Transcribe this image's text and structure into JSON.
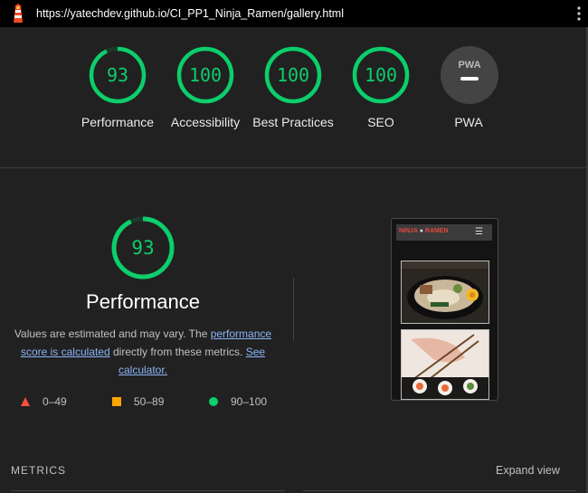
{
  "browser": {
    "url": "https://yatechdev.github.io/CI_PP1_Ninja_Ramen/gallery.html"
  },
  "summary": {
    "gauges": [
      {
        "label": "Performance",
        "score": "93",
        "fraction": 0.93
      },
      {
        "label": "Accessibility",
        "score": "100",
        "fraction": 1.0
      },
      {
        "label": "Best Practices",
        "score": "100",
        "fraction": 1.0
      },
      {
        "label": "SEO",
        "score": "100",
        "fraction": 1.0
      }
    ],
    "pwa": {
      "label": "PWA",
      "badge_text": "PWA"
    }
  },
  "performance": {
    "score": "93",
    "fraction": 0.93,
    "title": "Performance",
    "desc_prefix": "Values are estimated and may vary. The ",
    "desc_link1": "performance score is calculated",
    "desc_middle": " directly from these metrics. ",
    "desc_link2": "See calculator.",
    "legend": [
      {
        "range": "0–49",
        "color": "#ff4e42",
        "shape": "triangle"
      },
      {
        "range": "50–89",
        "color": "#ffa400",
        "shape": "square"
      },
      {
        "range": "90–100",
        "color": "#0cce6b",
        "shape": "circle"
      }
    ]
  },
  "screenshot": {
    "brand_left": "NINJA",
    "brand_right": "RAMEN"
  },
  "metrics": {
    "heading": "METRICS",
    "expand_label": "Expand view"
  },
  "colors": {
    "pass": "#0cce6b",
    "background": "#212121",
    "link": "#8ab4f8"
  }
}
